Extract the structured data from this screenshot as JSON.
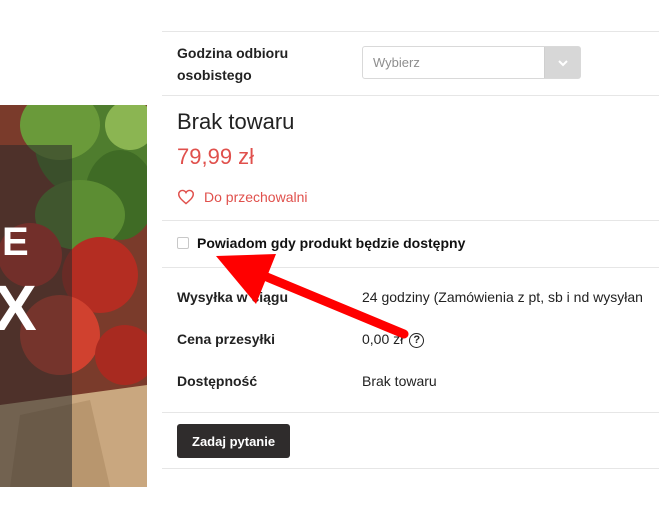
{
  "pickup": {
    "label": "Godzina odbioru osobistego",
    "select_placeholder": "Wybierz"
  },
  "product": {
    "title": "Brak towaru",
    "price": "79,99 zł"
  },
  "wishlist": {
    "label": "Do przechowalni"
  },
  "notify": {
    "label": "Powiadom gdy produkt będzie dostępny"
  },
  "details": [
    {
      "label": "Wysyłka w ciągu",
      "value": "24 godziny (Zamówienia z pt, sb i nd wysyłan"
    },
    {
      "label": "Cena przesyłki",
      "value": "0,00 zł"
    },
    {
      "label": "Dostępność",
      "value": "Brak towaru"
    }
  ],
  "help_glyph": "?",
  "ask_button": {
    "label": "Zadaj pytanie"
  },
  "colors": {
    "price": "#e0504c",
    "button": "#2f2c2c",
    "arrow": "#ff0000"
  }
}
